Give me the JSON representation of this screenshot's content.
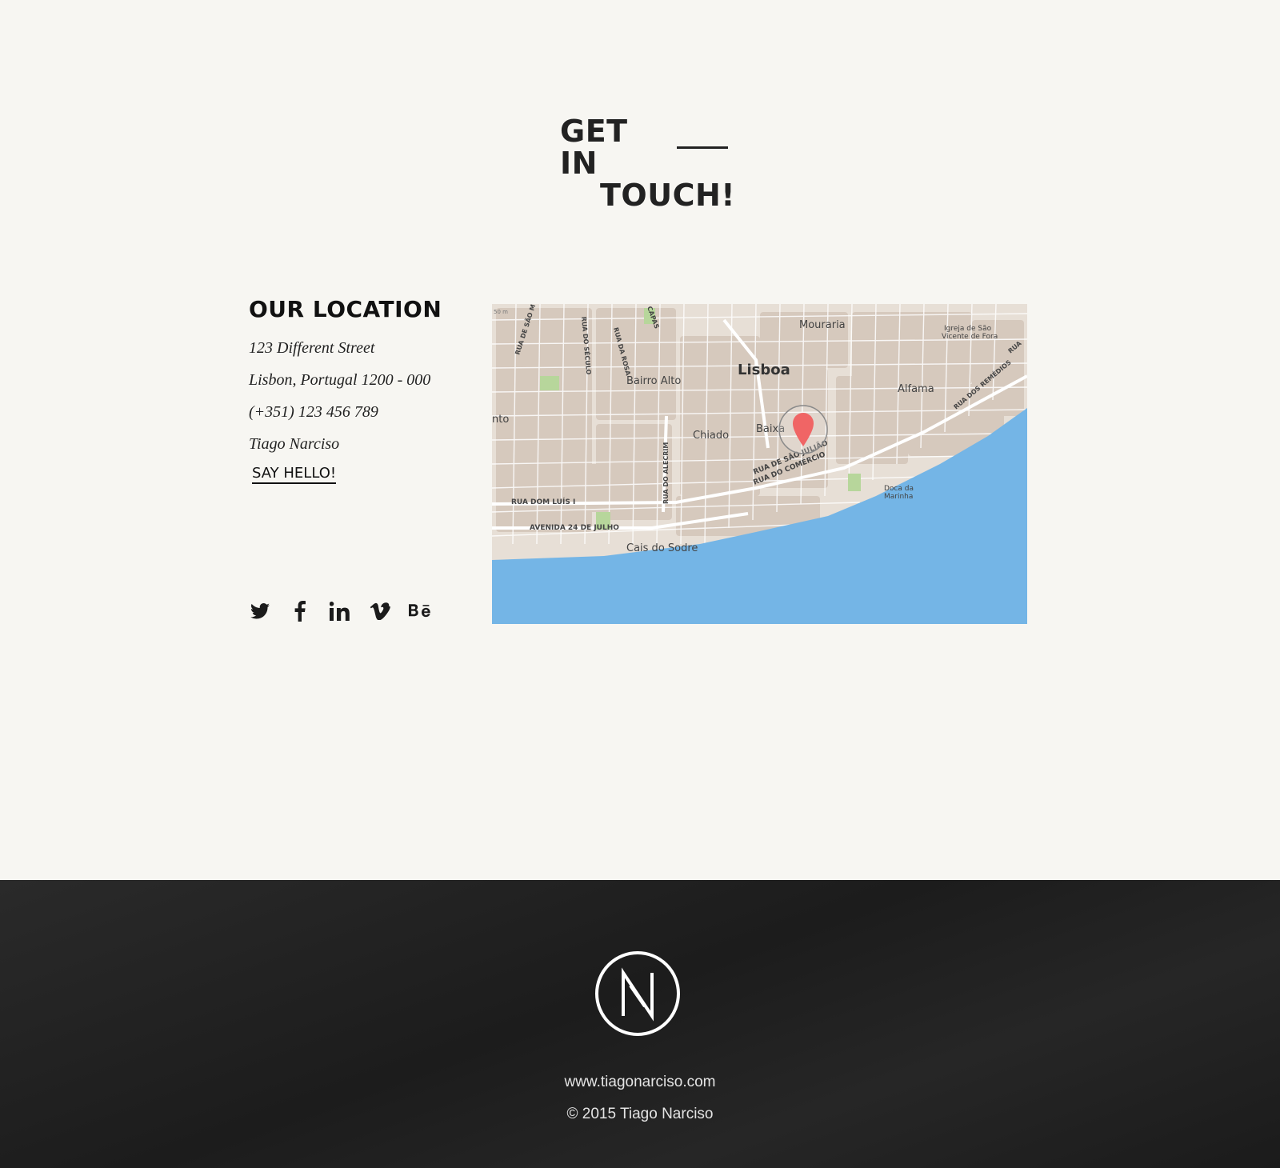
{
  "heading": {
    "line1": "GET IN",
    "line2": "TOUCH!"
  },
  "location": {
    "title": "OUR LOCATION",
    "lines": [
      "123 Different Street",
      "Lisbon, Portugal 1200 - 000",
      "(+351) 123 456 789",
      "Tiago Narciso"
    ],
    "cta": "SAY HELLO!"
  },
  "social": [
    "twitter-icon",
    "facebook-icon",
    "linkedin-icon",
    "vimeo-icon",
    "behance-icon"
  ],
  "map": {
    "labels": {
      "lisboa": "Lisboa",
      "mouraria": "Mouraria",
      "igreja1": "Igreja de São",
      "igreja2": "Vicente de Fora",
      "bairro": "Bairro Alto",
      "alfama": "Alfama",
      "chiado": "Chiado",
      "baixa": "Baixa",
      "cais": "Cais do Sodre",
      "doca1": "Doca da",
      "doca2": "Marinha",
      "nto": "nto",
      "dom_luis": "RUA DOM LUÍS I",
      "av24": "AVENIDA 24 DE JULHO",
      "sao_juliao": "RUA DE SÃO JULIÃO",
      "comercio": "RUA DO COMÉRCIO",
      "alecrim": "RUA DO ALECRIM",
      "remedios": "RUA DOS REMÉDIOS",
      "seculo": "RUA DO SÉCULO",
      "rosa": "RUA DA ROSA",
      "sao_m": "RUA DE SÃO M",
      "capas": "CAPAS",
      "rua": "RUA",
      "scale": "50 m"
    },
    "colors": {
      "water": "#74b5e6",
      "land": "#e7dfd6",
      "blocks": "#d2c3b6",
      "parks": "#b7d69b",
      "pin": "#f06565"
    }
  },
  "footer": {
    "website": "www.tiagonarciso.com",
    "copyright": "© 2015   Tiago Narciso"
  }
}
